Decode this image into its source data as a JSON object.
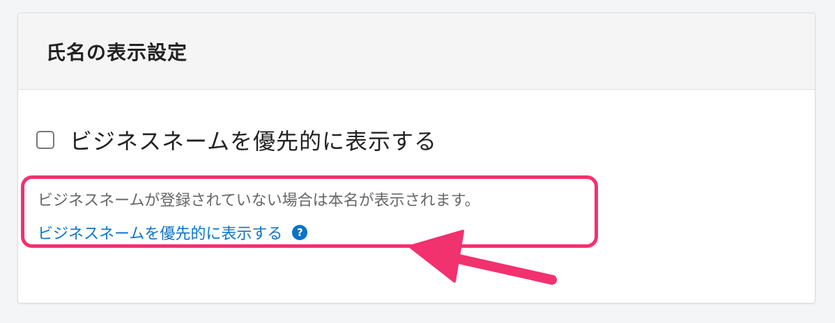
{
  "panel": {
    "title": "氏名の表示設定"
  },
  "option": {
    "checkbox_label": "ビジネスネームを優先的に表示する",
    "checked": false
  },
  "help": {
    "description": "ビジネスネームが登録されていない場合は本名が表示されます。",
    "link_text": "ビジネスネームを優先的に表示する",
    "icon_glyph": "?"
  },
  "annotation": {
    "highlight_color": "#f2316f",
    "arrow_color": "#f2316f"
  }
}
